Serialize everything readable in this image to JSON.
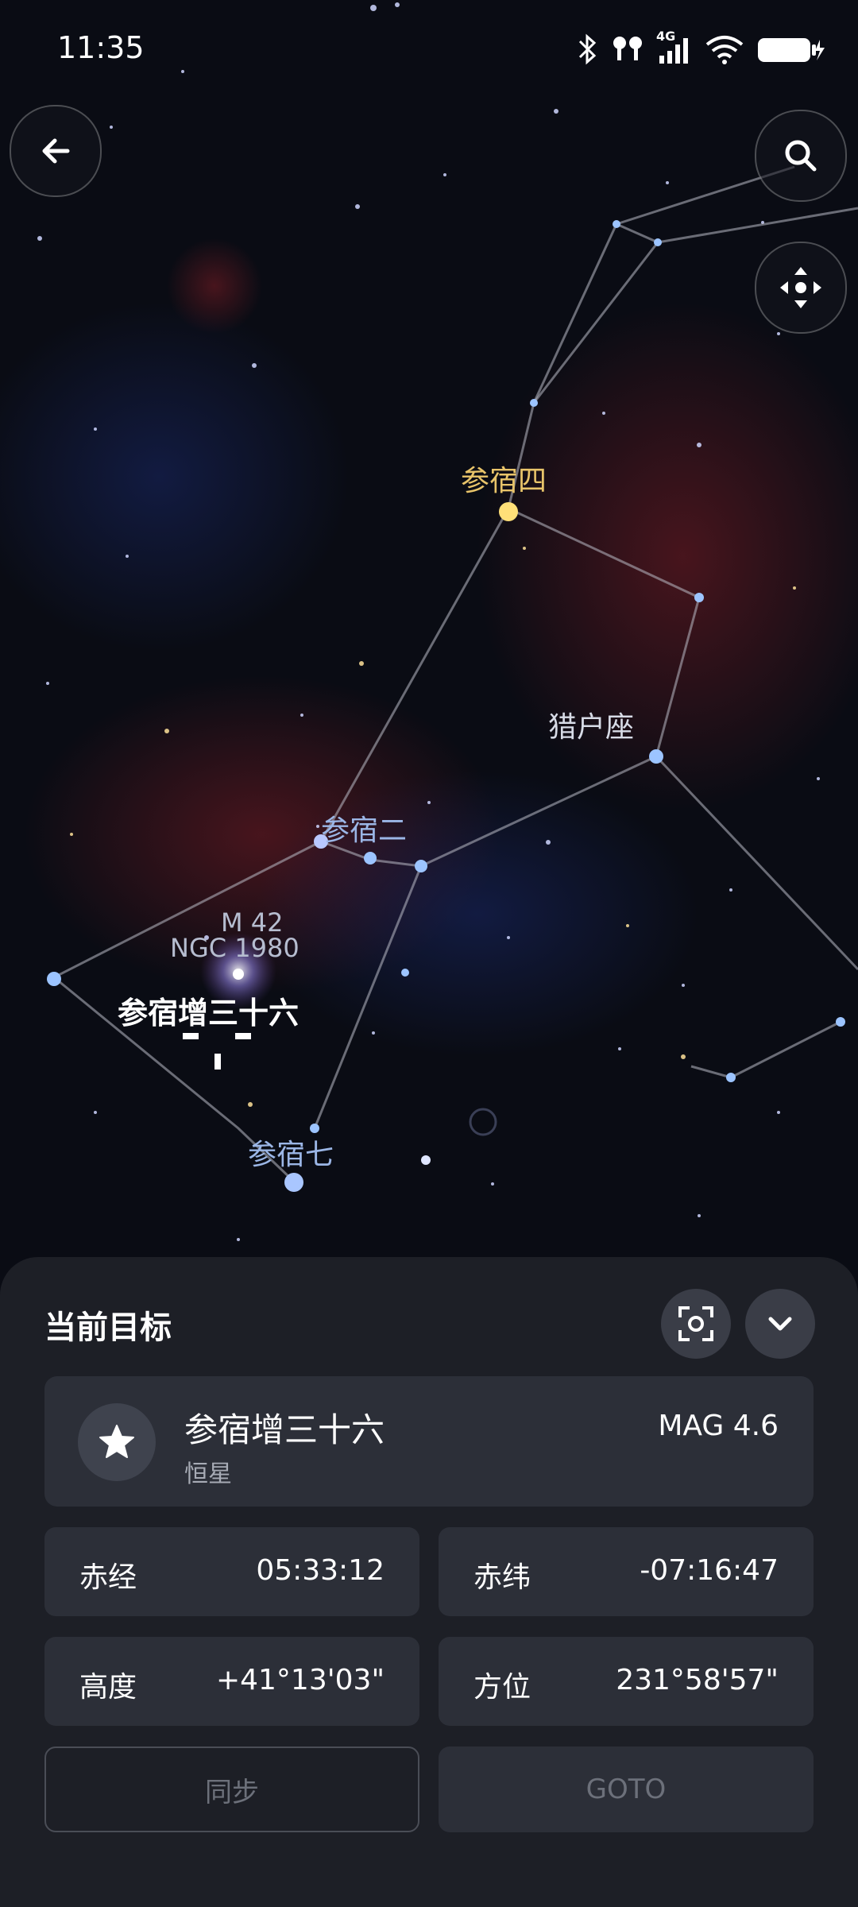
{
  "status": {
    "time": "11:35",
    "network": "4G"
  },
  "sky_labels": {
    "betelgeuse": "参宿四",
    "orion": "猎户座",
    "alnilam": "参宿二",
    "m42": "M 42",
    "ngc": "NGC 1980",
    "target": "参宿增三十六",
    "saiph": "参宿七"
  },
  "panel": {
    "title": "当前目标",
    "target": {
      "name": "参宿增三十六",
      "type": "恒星",
      "mag": "MAG 4.6"
    },
    "coords": [
      {
        "label": "赤经",
        "value": "05:33:12"
      },
      {
        "label": "赤纬",
        "value": "-07:16:47"
      },
      {
        "label": "高度",
        "value": "+41°13'03\""
      },
      {
        "label": "方位",
        "value": "231°58'57\""
      }
    ],
    "sync_label": "同步",
    "goto_label": "GOTO"
  },
  "colors": {
    "panel_bg": "#1d1f26",
    "card_bg": "#2c2f38",
    "star_label_gold": "#e8c46a",
    "star_label_blue": "#9bb6e6"
  }
}
